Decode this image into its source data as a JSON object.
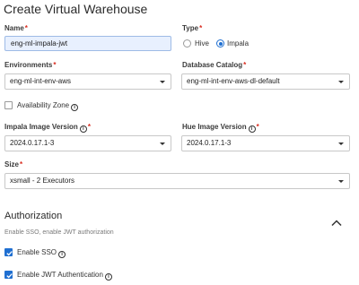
{
  "page_title": "Create Virtual Warehouse",
  "fields": {
    "name": {
      "label": "Name",
      "required": "*",
      "value": "eng-ml-impala-jwt"
    },
    "type": {
      "label": "Type",
      "required": "*",
      "options": [
        "Hive",
        "Impala"
      ],
      "selected": "Impala"
    },
    "environments": {
      "label": "Environments",
      "required": "*",
      "value": "eng-ml-int-env-aws"
    },
    "database_catalog": {
      "label": "Database Catalog",
      "required": "*",
      "value": "eng-ml-int-env-aws-dl-default"
    },
    "availability_zone": {
      "label": "Availability Zone",
      "checked": false,
      "info_icon": "info-icon"
    },
    "impala_image_version": {
      "label": "Impala Image Version",
      "required": "*",
      "value": "2024.0.17.1-3",
      "info_icon": "info-icon"
    },
    "hue_image_version": {
      "label": "Hue Image Version",
      "required": "*",
      "value": "2024.0.17.1-3",
      "info_icon": "info-icon"
    },
    "size": {
      "label": "Size",
      "required": "*",
      "value": "xsmall - 2 Executors"
    }
  },
  "authorization": {
    "title": "Authorization",
    "subtitle": "Enable SSO, enable JWT authorization",
    "collapse_icon": "chevron-up-icon",
    "enable_sso": {
      "label": "Enable SSO",
      "checked": true,
      "info_icon": "info-icon"
    },
    "enable_jwt": {
      "label": "Enable JWT Authentication",
      "checked": true,
      "info_icon": "info-icon"
    }
  },
  "icons": {
    "info_glyph": "i"
  },
  "colors": {
    "accent": "#1f6fd1",
    "required": "#d92d20",
    "input_autofill_bg": "#e8f0fe"
  }
}
